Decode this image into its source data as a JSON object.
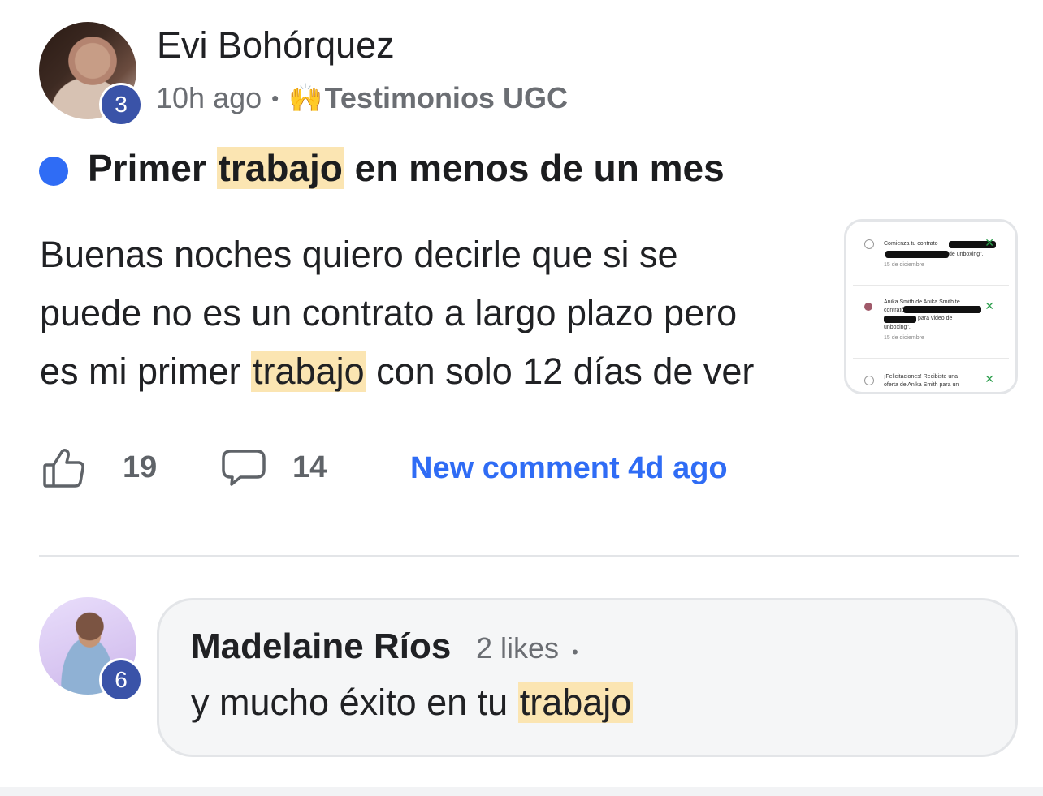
{
  "post": {
    "author": "Evi Bohórquez",
    "author_level": "3",
    "time_ago": "10h ago",
    "separator": "•",
    "category_emoji": "🙌",
    "category": "Testimonios UGC",
    "title_before": "Primer ",
    "title_highlight": "trabajo",
    "title_after": " en menos de un mes",
    "body_line1": "Buenas noches quiero decirle que si se",
    "body_line2": "puede no es un contrato a largo plazo pero",
    "body_line3_before": "es mi primer ",
    "body_line3_highlight": "trabajo",
    "body_line3_after": " con solo 12 días de ver",
    "likes": "19",
    "comments": "14",
    "new_comment": "New comment 4d ago"
  },
  "thumbnail": {
    "notif1_text": "Comienza tu contrato",
    "notif1_sub": "de unboxing\".",
    "notif1_date": "15 de diciembre",
    "notif2_text": "Anika Smith de Anika Smith te",
    "notif2_text2": "contrató",
    "notif2_text3": "para video de",
    "notif2_text4": "unboxing\".",
    "notif2_date": "15 de diciembre",
    "notif3_text": "¡Felicitaciones! Recibiste una",
    "notif3_text2": "oferta de Anika Smith para un"
  },
  "comment": {
    "author": "Madelaine Ríos",
    "author_level": "6",
    "likes": "2 likes",
    "separator": "•",
    "text_before": "y mucho éxito en tu ",
    "text_highlight": "trabajo"
  },
  "colors": {
    "accent": "#2f6cf5",
    "highlight": "#fbe5b2",
    "level_badge": "#3a53a8",
    "muted": "#6b6e73"
  }
}
